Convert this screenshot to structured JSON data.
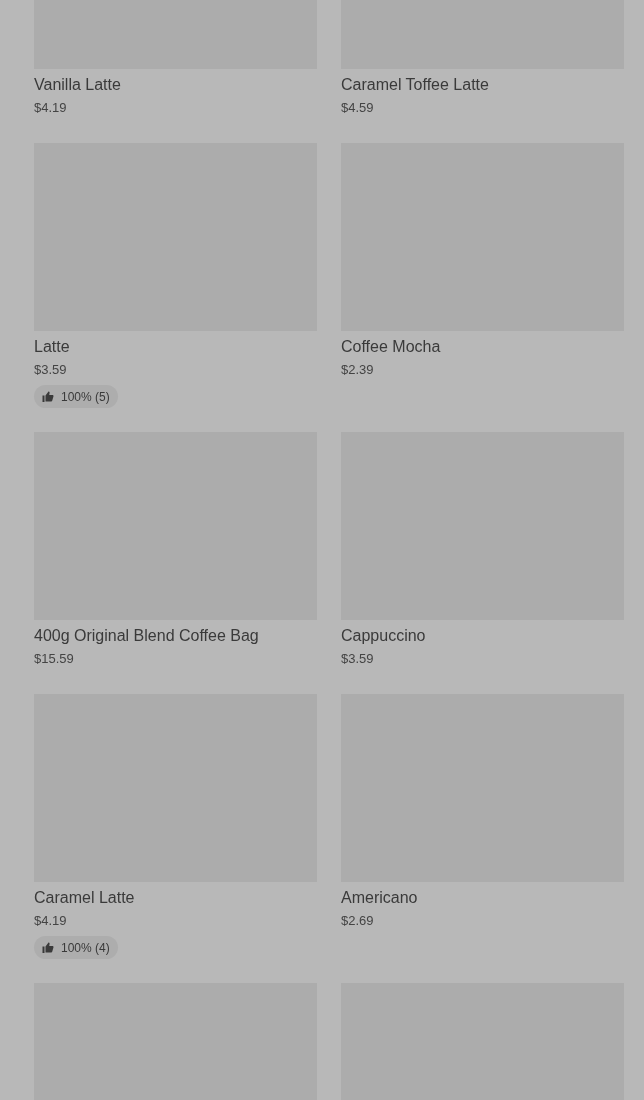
{
  "products": [
    {
      "kind": "product",
      "name": "Vanilla Latte",
      "price": "$4.19"
    },
    {
      "kind": "product",
      "name": "Caramel Toffee Latte",
      "price": "$4.59"
    },
    {
      "kind": "product",
      "name": "Latte",
      "price": "$3.59",
      "rating": "100% (5)"
    },
    {
      "kind": "product",
      "name": "Coffee Mocha",
      "price": "$2.39"
    },
    {
      "kind": "product",
      "name": "400g Original Blend Coffee Bag",
      "price": "$15.59"
    },
    {
      "kind": "product",
      "name": "Cappuccino",
      "price": "$3.59"
    },
    {
      "kind": "product",
      "name": "Caramel Latte",
      "price": "$4.19",
      "rating": "100% (4)"
    },
    {
      "kind": "product",
      "name": "Americano",
      "price": "$2.69"
    },
    {
      "kind": "picture"
    },
    {
      "kind": "picture"
    }
  ]
}
